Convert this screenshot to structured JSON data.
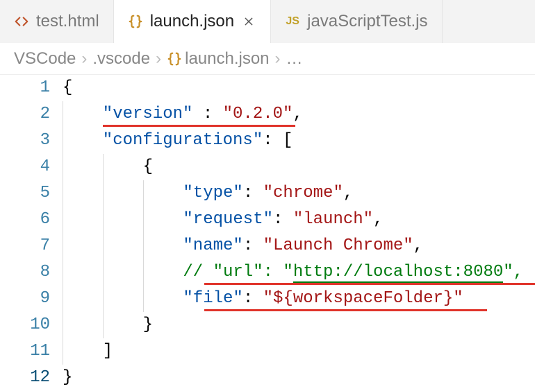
{
  "tabs": [
    {
      "label": "test.html",
      "icon": "html-icon",
      "active": false
    },
    {
      "label": "launch.json",
      "icon": "json-icon",
      "active": true
    },
    {
      "label": "javaScriptTest.js",
      "icon": "js-icon",
      "active": false
    }
  ],
  "breadcrumbs": {
    "segments": [
      "VSCode",
      ".vscode",
      "launch.json"
    ],
    "tail": "…",
    "file_icon": "json-icon"
  },
  "editor": {
    "current_line": 12,
    "lines": [
      "1",
      "2",
      "3",
      "4",
      "5",
      "6",
      "7",
      "8",
      "9",
      "10",
      "11",
      "12"
    ],
    "tokens": {
      "l1": [
        {
          "t": "{",
          "cls": "p"
        }
      ],
      "l2": [
        {
          "t": "\"version\"",
          "cls": "k"
        },
        {
          "t": " : ",
          "cls": "p"
        },
        {
          "t": "\"0.2.0\"",
          "cls": "s"
        },
        {
          "t": ",",
          "cls": "p"
        }
      ],
      "l3": [
        {
          "t": "\"configurations\"",
          "cls": "k"
        },
        {
          "t": ": [",
          "cls": "p"
        }
      ],
      "l4": [
        {
          "t": "{",
          "cls": "p"
        }
      ],
      "l5": [
        {
          "t": "\"type\"",
          "cls": "k"
        },
        {
          "t": ": ",
          "cls": "p"
        },
        {
          "t": "\"chrome\"",
          "cls": "s"
        },
        {
          "t": ",",
          "cls": "p"
        }
      ],
      "l6": [
        {
          "t": "\"request\"",
          "cls": "k"
        },
        {
          "t": ": ",
          "cls": "p"
        },
        {
          "t": "\"launch\"",
          "cls": "s"
        },
        {
          "t": ",",
          "cls": "p"
        }
      ],
      "l7": [
        {
          "t": "\"name\"",
          "cls": "k"
        },
        {
          "t": ": ",
          "cls": "p"
        },
        {
          "t": "\"Launch Chrome\"",
          "cls": "s"
        },
        {
          "t": ",",
          "cls": "p"
        }
      ],
      "l8": [
        {
          "t": "// \"url\": \"",
          "cls": "c"
        },
        {
          "t": "http://localhost:8080",
          "cls": "c underline"
        },
        {
          "t": "\",",
          "cls": "c"
        }
      ],
      "l9": [
        {
          "t": "\"file\"",
          "cls": "k"
        },
        {
          "t": ": ",
          "cls": "p"
        },
        {
          "t": "\"${workspaceFolder}\"",
          "cls": "s"
        }
      ],
      "l10": [
        {
          "t": "}",
          "cls": "p"
        }
      ],
      "l11": [
        {
          "t": "]",
          "cls": "p"
        }
      ],
      "l12": [
        {
          "t": "}",
          "cls": "p"
        }
      ]
    },
    "indents": {
      "l1": 0,
      "l2": 1,
      "l3": 1,
      "l4": 2,
      "l5": 3,
      "l6": 3,
      "l7": 3,
      "l8": 3,
      "l9": 3,
      "l10": 2,
      "l11": 1,
      "l12": 0
    },
    "redlines": [
      {
        "line": 2,
        "left_ch": 1,
        "width_ch": 19.2
      },
      {
        "line": 8,
        "left_ch": 3.1,
        "width_ch": 33.8
      },
      {
        "line": 9,
        "left_ch": 3.1,
        "width_ch": 28.2
      }
    ]
  },
  "colors": {
    "annotation_red": "#e0342b"
  }
}
